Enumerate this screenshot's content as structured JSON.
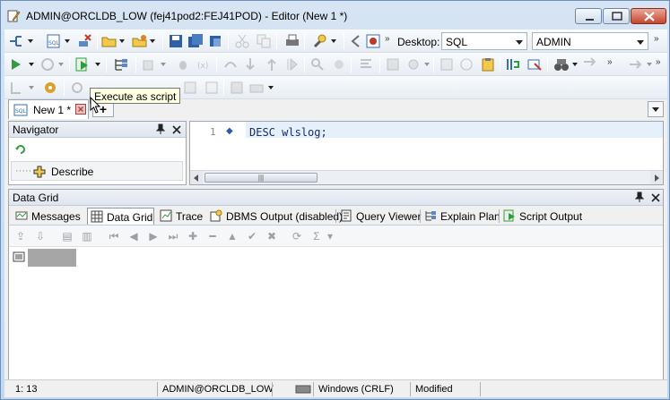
{
  "window": {
    "title": "ADMIN@ORCLDB_LOW (fej41pod2:FEJ41POD) - Editor (New 1 *)"
  },
  "toolbar": {
    "desktop_label": "Desktop:",
    "desktop_value": "SQL",
    "connection_value": "ADMIN"
  },
  "tooltip": {
    "text": "Execute as script"
  },
  "editor_tab": {
    "label": "New 1 *",
    "add_label": "+"
  },
  "navigator": {
    "title": "Navigator",
    "describe_label": "Describe"
  },
  "editor": {
    "line_number": "1",
    "code": "DESC wlslog;"
  },
  "data_grid": {
    "title": "Data Grid",
    "tabs": [
      {
        "label": "Messages"
      },
      {
        "label": "Data Grid"
      },
      {
        "label": "Trace"
      },
      {
        "label": "DBMS Output (disabled)"
      },
      {
        "label": "Query Viewer"
      },
      {
        "label": "Explain Plan"
      },
      {
        "label": "Script Output"
      }
    ]
  },
  "status": {
    "position": "1:  13",
    "connection": "ADMIN@ORCLDB_LOW",
    "line_endings": "Windows (CRLF)",
    "state": "Modified"
  },
  "colors": {
    "accent": "#2b5aa8",
    "frame": "#c9dcef",
    "tooltip_bg": "#ffffe1"
  }
}
